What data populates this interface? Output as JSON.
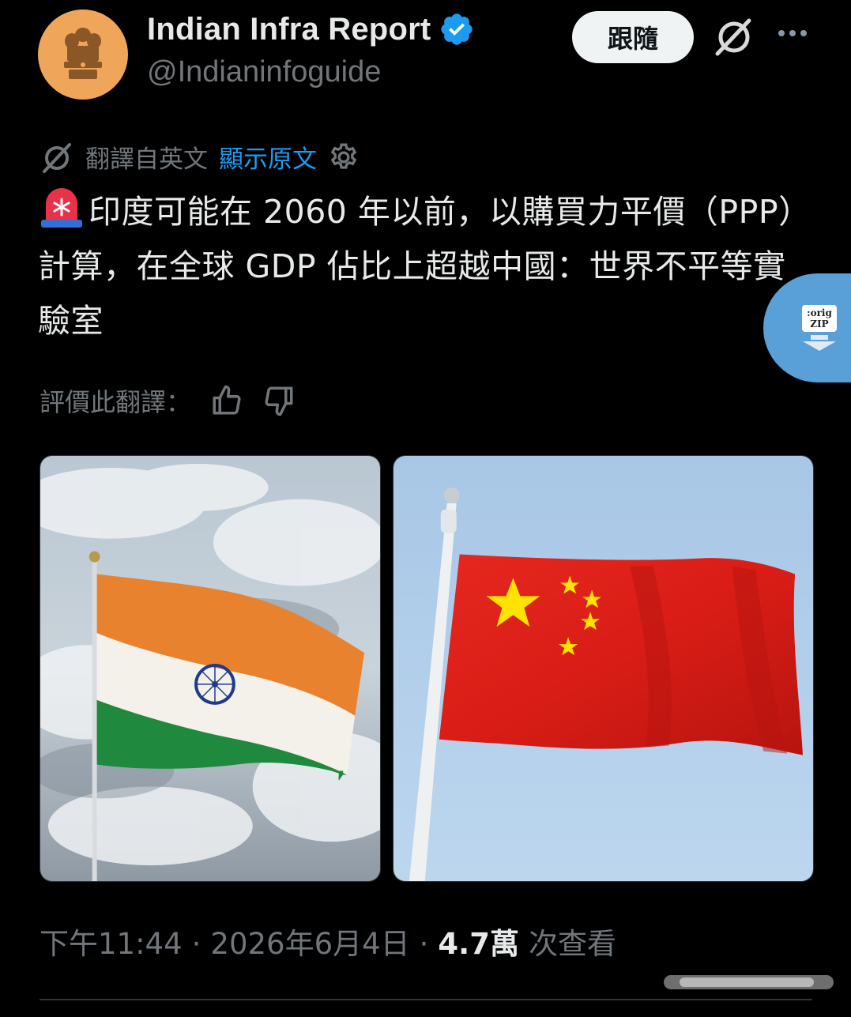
{
  "author": {
    "display_name": "Indian Infra Report",
    "handle": "@Indianinfoguide",
    "verified": true,
    "avatar": "ashoka-emblem-icon",
    "avatar_color": "#f0a65a"
  },
  "header": {
    "follow_label": "跟隨",
    "grok_icon": "grok-icon",
    "more_icon": "more-icon"
  },
  "translation": {
    "label": "翻譯自英文",
    "show_original": "顯示原文",
    "rate_label": "評價此翻譯："
  },
  "tweet": {
    "text": "印度可能在 2060 年以前，以購買力平價（PPP）計算，在全球 GDP 佔比上超越中國：世界不平等實驗室"
  },
  "overlay": {
    "line1": ":orig",
    "line2": "ZIP"
  },
  "media": [
    {
      "subject": "India flag",
      "alt": ""
    },
    {
      "subject": "China flag",
      "alt": ""
    }
  ],
  "meta": {
    "time": "下午11:44",
    "date": "2026年6月4日",
    "views": "4.7萬",
    "views_label": "次查看"
  },
  "colors": {
    "accent": "#1d9bf0",
    "text": "#e7e9ea",
    "muted": "#71767b",
    "background": "#000000"
  }
}
